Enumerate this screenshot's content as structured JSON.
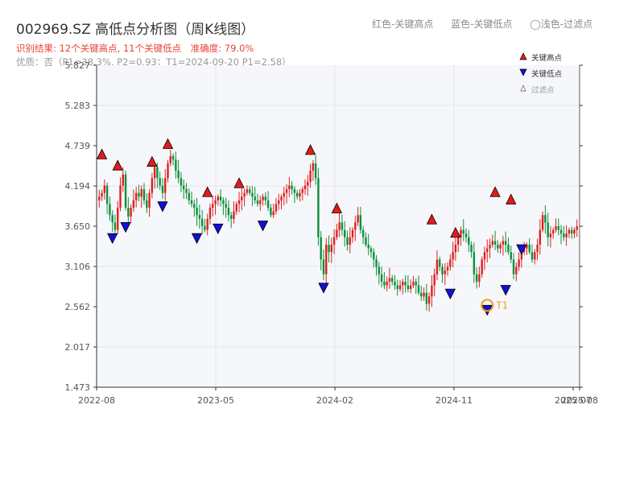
{
  "title": "002969.SZ 高低点分析图（周K线图）",
  "subtitle": {
    "result": "识别结果: 12个关键高点, 11个关键低点",
    "accuracy": "准确度: 79.0%",
    "quality": "优质：否（P1=38.3%, P2=0.93；T1=2024-09-20 P1=2.58）"
  },
  "top_legend": {
    "red": "红色-关键高点",
    "blue": "蓝色-关键低点",
    "gray": "◯浅色-过滤点"
  },
  "legend": {
    "high": "关键高点",
    "low": "关键低点",
    "filtered": "过滤点"
  },
  "colors": {
    "up": "#e02020",
    "down": "#0e8f3c",
    "high_marker": "#e31b1b",
    "low_marker": "#1010d8",
    "t1": "#f59a23",
    "plot_bg": "#f5f7fa",
    "grid": "#e3e6ea"
  },
  "chart_data": {
    "type": "candlestick",
    "x_ticks": [
      "2022-08",
      "2023-05",
      "2024-02",
      "2024-11",
      "2025-07",
      "2025-08"
    ],
    "y_ticks": [
      "1.473",
      "2.017",
      "2.562",
      "3.106",
      "3.650",
      "4.194",
      "4.739",
      "5.283",
      "5.827"
    ],
    "ylim": [
      1.473,
      5.827
    ],
    "t1_label": "T1",
    "t1": {
      "week": 147,
      "price": 2.58
    },
    "close": [
      4.05,
      4.1,
      4.2,
      3.95,
      3.8,
      3.7,
      3.6,
      3.9,
      4.2,
      4.35,
      3.9,
      3.78,
      3.9,
      4.0,
      4.1,
      4.05,
      4.15,
      4.0,
      3.9,
      4.1,
      4.3,
      4.45,
      4.3,
      4.2,
      4.1,
      4.3,
      4.5,
      4.6,
      4.55,
      4.4,
      4.3,
      4.2,
      4.15,
      4.1,
      4.0,
      3.95,
      3.9,
      3.8,
      3.75,
      3.65,
      3.6,
      3.75,
      3.9,
      3.95,
      4.0,
      4.05,
      4.0,
      3.95,
      3.9,
      3.8,
      3.75,
      3.85,
      3.95,
      4.0,
      4.05,
      4.1,
      4.15,
      4.1,
      4.05,
      4.0,
      3.95,
      4.0,
      4.05,
      4.0,
      3.9,
      3.8,
      3.85,
      3.95,
      4.0,
      4.05,
      4.1,
      4.15,
      4.2,
      4.15,
      4.1,
      4.05,
      4.1,
      4.15,
      4.2,
      4.25,
      4.4,
      4.5,
      4.3,
      3.5,
      3.2,
      3.0,
      3.4,
      3.3,
      3.4,
      3.5,
      3.6,
      3.7,
      3.6,
      3.5,
      3.4,
      3.5,
      3.6,
      3.7,
      3.8,
      3.6,
      3.5,
      3.4,
      3.35,
      3.3,
      3.2,
      3.1,
      3.0,
      2.9,
      2.85,
      2.9,
      2.95,
      2.9,
      2.85,
      2.8,
      2.85,
      2.9,
      2.85,
      2.8,
      2.85,
      2.9,
      2.85,
      2.75,
      2.7,
      2.75,
      2.6,
      2.7,
      2.85,
      3.0,
      3.2,
      3.1,
      3.0,
      3.05,
      3.1,
      3.2,
      3.3,
      3.4,
      3.5,
      3.6,
      3.55,
      3.5,
      3.4,
      3.3,
      3.0,
      2.9,
      3.0,
      3.2,
      3.3,
      3.35,
      3.4,
      3.45,
      3.4,
      3.35,
      3.4,
      3.45,
      3.4,
      3.3,
      3.2,
      3.0,
      3.1,
      3.2,
      3.3,
      3.35,
      3.4,
      3.3,
      3.2,
      3.3,
      3.4,
      3.6,
      3.8,
      3.7,
      3.5,
      3.55,
      3.6,
      3.65,
      3.6,
      3.55,
      3.5,
      3.55,
      3.6,
      3.55,
      3.6,
      3.65
    ],
    "highs": [
      [
        1,
        4.56
      ],
      [
        7,
        4.41
      ],
      [
        20,
        4.46
      ],
      [
        26,
        4.7
      ],
      [
        41,
        4.05
      ],
      [
        53,
        4.17
      ],
      [
        80,
        4.62
      ],
      [
        90,
        3.83
      ],
      [
        126,
        3.68
      ],
      [
        135,
        3.5
      ],
      [
        150,
        4.05
      ],
      [
        156,
        3.95
      ]
    ],
    "lows": [
      [
        5,
        3.55
      ],
      [
        10,
        3.7
      ],
      [
        24,
        3.98
      ],
      [
        37,
        3.55
      ],
      [
        45,
        3.68
      ],
      [
        62,
        3.72
      ],
      [
        85,
        2.88
      ],
      [
        133,
        2.8
      ],
      [
        147,
        2.58
      ],
      [
        154,
        2.85
      ],
      [
        160,
        3.4
      ]
    ]
  }
}
